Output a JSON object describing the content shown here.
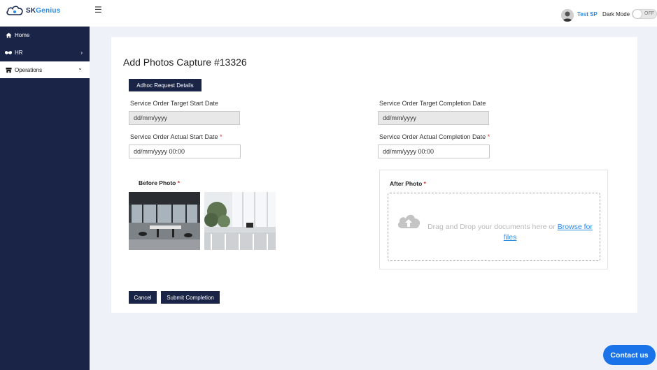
{
  "header": {
    "logo": {
      "text_a": "SK",
      "text_b": "Genius"
    },
    "user_name": "Test SP",
    "dark_mode_label": "Dark Mode",
    "dark_mode_state": "OFF"
  },
  "sidebar": {
    "items": [
      {
        "label": "Home",
        "icon": "home-icon"
      },
      {
        "label": "HR",
        "icon": "handshake-icon",
        "chevron": "›"
      },
      {
        "label": "Operations",
        "icon": "store-icon",
        "chevron": "⌄"
      }
    ]
  },
  "page": {
    "title": "Add Photos Capture #13326",
    "adhoc_button": "Adhoc Request Details",
    "target_start_label": "Service Order Target Start Date",
    "target_start_value": "dd/mm/yyyy",
    "target_completion_label": "Service Order Target Completion Date",
    "target_completion_value": "dd/mm/yyyy",
    "actual_start_label": "Service Order Actual Start Date",
    "actual_start_value": "dd/mm/yyyy 00:00",
    "actual_completion_label": "Service Order Actual Completion Date",
    "actual_completion_value": "dd/mm/yyyy 00:00",
    "required_mark": "*",
    "before_photo_label": "Before Photo",
    "after_photo_label": "After Photo",
    "dropzone_text": "Drag and Drop your documents here or ",
    "dropzone_link": "Browse for files",
    "cancel_button": "Cancel",
    "submit_button": "Submit Completion"
  },
  "contact_button": "Contact us",
  "colors": {
    "navy": "#1a2447",
    "accent": "#2b8be6",
    "contact": "#1a73e8"
  }
}
